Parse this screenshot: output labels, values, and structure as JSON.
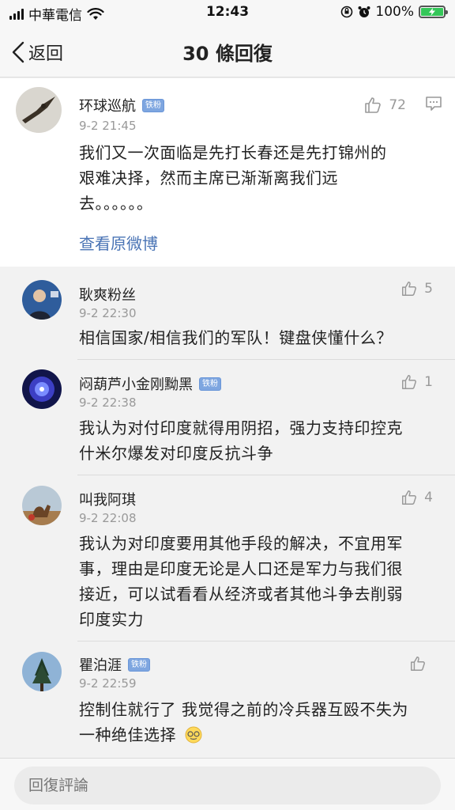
{
  "status_bar": {
    "carrier": "中華電信",
    "time": "12:43",
    "battery_percent": "100%"
  },
  "nav": {
    "back_label": "返回",
    "title": "30 條回復"
  },
  "main_post": {
    "user": "环球巡航",
    "badge": "铁粉",
    "time": "9-2 21:45",
    "likes": "72",
    "text_lines": [
      "我们又一次面临是先打长春还是先打锦州的",
      "艰难决择，然而主席已渐渐离我们远",
      "去。。。。。。"
    ],
    "link": "查看原微博",
    "icons": [
      "like-icon",
      "comment-icon"
    ]
  },
  "replies": [
    {
      "user": "耿爽粉丝",
      "badge": "",
      "time": "9-2 22:30",
      "likes": "5",
      "text_lines": [
        "相信国家/相信我们的军队！键盘侠懂什么？"
      ]
    },
    {
      "user": "闷葫芦小金刚黝黑",
      "badge": "铁粉",
      "time": "9-2 22:38",
      "likes": "1",
      "text_lines": [
        "我认为对付印度就得用阴招，强力支持印控克",
        "什米尔爆发对印度反抗斗争"
      ]
    },
    {
      "user": "叫我阿琪",
      "badge": "",
      "time": "9-2 22:08",
      "likes": "4",
      "text_lines": [
        "我认为对印度要用其他手段的解决，不宜用军",
        "事，理由是印度无论是人口还是军力与我们很",
        "接近，可以试看看从经济或者其他斗争去削弱",
        "印度实力"
      ]
    },
    {
      "user": "瞿泊涯",
      "badge": "铁粉",
      "time": "9-2 22:59",
      "likes": "",
      "text_lines": [
        "控制住就行了 我觉得之前的冷兵器互殴不失为",
        "一种绝佳选择"
      ]
    }
  ],
  "bottom": {
    "reply_placeholder": "回復評論"
  },
  "colors": {
    "link": "#4a74b5",
    "badge": "#7ea6e0",
    "battery": "#35c759",
    "secondary_text": "#999999"
  }
}
